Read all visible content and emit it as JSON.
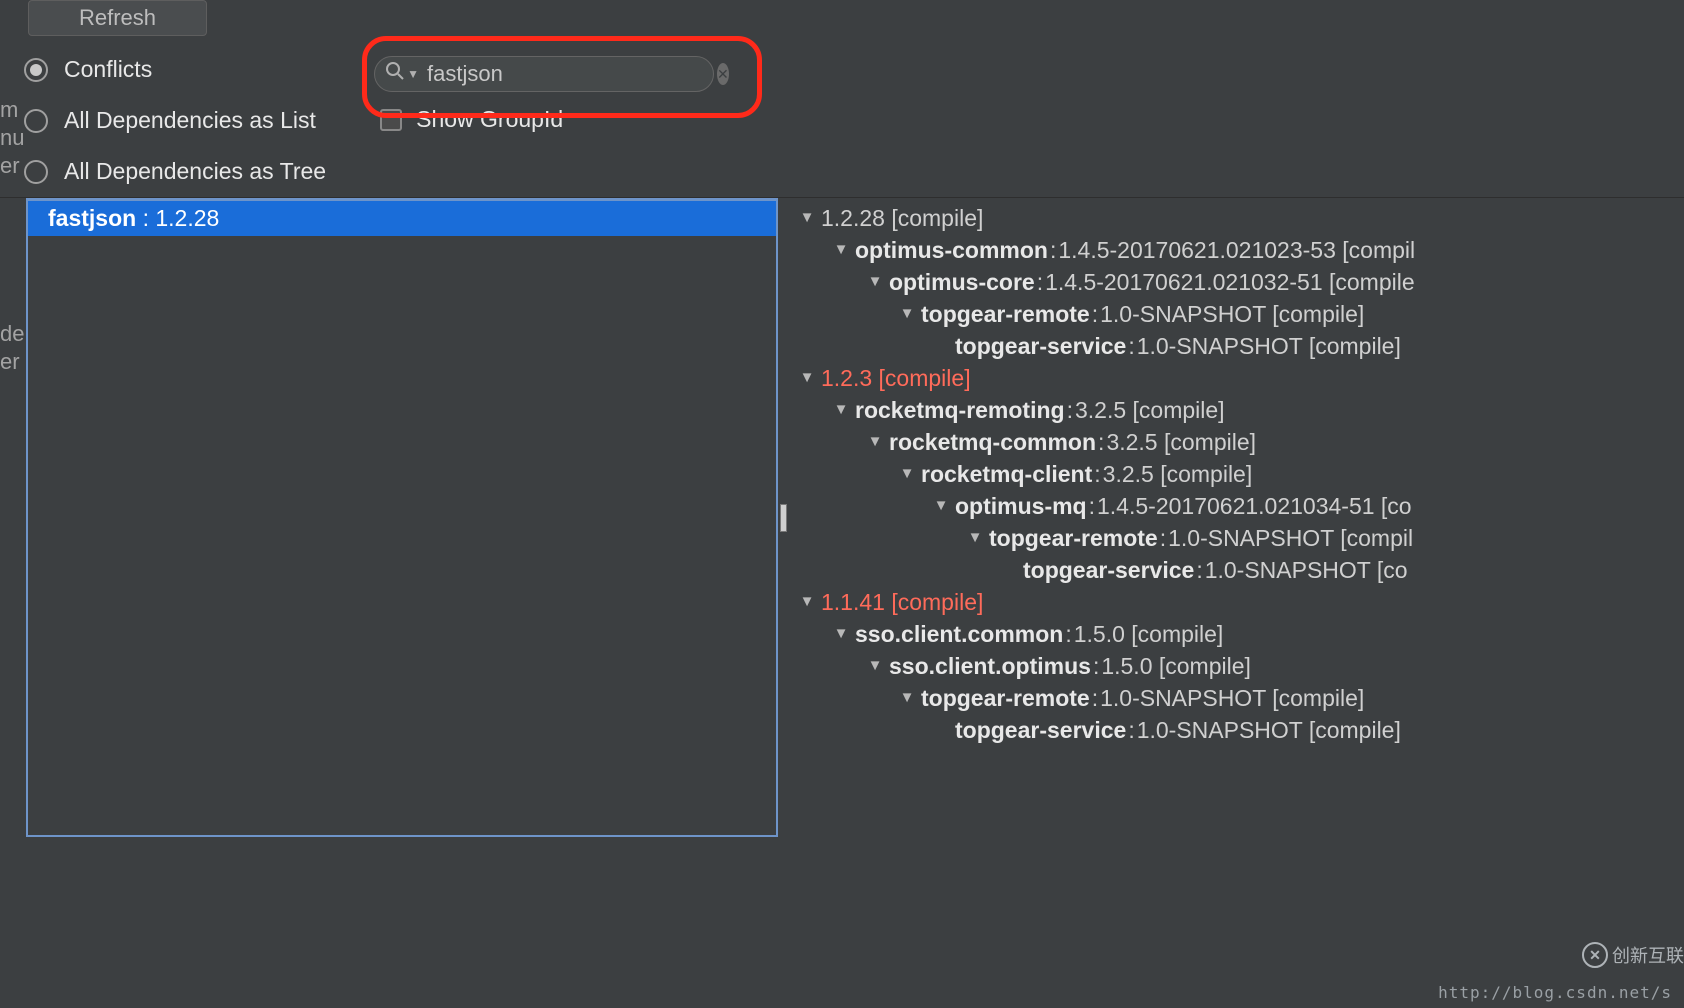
{
  "toolbar": {
    "refresh": "Refresh"
  },
  "radios": {
    "conflicts": "Conflicts",
    "all_list": "All Dependencies as List",
    "all_tree": "All Dependencies as Tree"
  },
  "search": {
    "value": "fastjson"
  },
  "checkbox": {
    "show_groupid": "Show GroupId"
  },
  "left_cut": {
    "c1": "m",
    "c2": "nu",
    "c3": "er",
    "c4": "de",
    "c5": "er"
  },
  "result": {
    "name": "fastjson",
    "sep": " : ",
    "version": "1.2.28"
  },
  "tree": [
    {
      "indent": 0,
      "twisty": true,
      "red": false,
      "name": "1.2.28 [compile]",
      "ver": ""
    },
    {
      "indent": 1,
      "twisty": true,
      "red": false,
      "name": "optimus-common",
      "ver": "1.4.5-20170621.021023-53 [compil"
    },
    {
      "indent": 2,
      "twisty": true,
      "red": false,
      "name": "optimus-core",
      "ver": "1.4.5-20170621.021032-51 [compile"
    },
    {
      "indent": 3,
      "twisty": true,
      "red": false,
      "name": "topgear-remote",
      "ver": "1.0-SNAPSHOT [compile]"
    },
    {
      "indent": 4,
      "twisty": false,
      "red": false,
      "name": "topgear-service",
      "ver": "1.0-SNAPSHOT [compile]"
    },
    {
      "indent": 0,
      "twisty": true,
      "red": true,
      "name": "1.2.3 [compile]",
      "ver": ""
    },
    {
      "indent": 1,
      "twisty": true,
      "red": false,
      "name": "rocketmq-remoting",
      "ver": "3.2.5 [compile]"
    },
    {
      "indent": 2,
      "twisty": true,
      "red": false,
      "name": "rocketmq-common",
      "ver": "3.2.5 [compile]"
    },
    {
      "indent": 3,
      "twisty": true,
      "red": false,
      "name": "rocketmq-client",
      "ver": "3.2.5 [compile]"
    },
    {
      "indent": 4,
      "twisty": true,
      "red": false,
      "name": "optimus-mq",
      "ver": "1.4.5-20170621.021034-51 [co"
    },
    {
      "indent": 5,
      "twisty": true,
      "red": false,
      "name": "topgear-remote",
      "ver": "1.0-SNAPSHOT [compil"
    },
    {
      "indent": 6,
      "twisty": false,
      "red": false,
      "name": "topgear-service",
      "ver": "1.0-SNAPSHOT [co"
    },
    {
      "indent": 0,
      "twisty": true,
      "red": true,
      "name": "1.1.41 [compile]",
      "ver": ""
    },
    {
      "indent": 1,
      "twisty": true,
      "red": false,
      "name": "sso.client.common",
      "ver": "1.5.0 [compile]"
    },
    {
      "indent": 2,
      "twisty": true,
      "red": false,
      "name": "sso.client.optimus",
      "ver": "1.5.0 [compile]"
    },
    {
      "indent": 3,
      "twisty": true,
      "red": false,
      "name": "topgear-remote",
      "ver": "1.0-SNAPSHOT [compile]"
    },
    {
      "indent": 4,
      "twisty": false,
      "red": false,
      "name": "topgear-service",
      "ver": "1.0-SNAPSHOT [compile]"
    }
  ],
  "watermark": {
    "url": "http://blog.csdn.net/s",
    "brand": "创新互联"
  }
}
